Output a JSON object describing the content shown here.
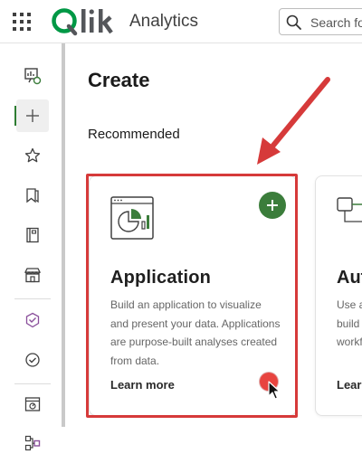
{
  "header": {
    "app_name": "Analytics",
    "search_placeholder": "Search for",
    "logo_text": "Qlik",
    "brand_color": "#2e7d32"
  },
  "sidebar": {
    "items": [
      {
        "icon": "analytics-home-icon"
      },
      {
        "icon": "plus-icon",
        "active": true
      },
      {
        "icon": "star-icon"
      },
      {
        "icon": "bookmark-icon"
      },
      {
        "icon": "notebook-icon"
      },
      {
        "icon": "store-icon"
      },
      {
        "icon": "cube-check-icon"
      },
      {
        "icon": "circle-check-icon"
      },
      {
        "icon": "app-gauge-icon"
      },
      {
        "icon": "flow-icon"
      }
    ]
  },
  "main": {
    "title": "Create",
    "section": "Recommended",
    "cards": [
      {
        "title": "Application",
        "description": "Build an application to visualize and present your data. Applications are purpose-built analyses created from data.",
        "link": "Learn more"
      },
      {
        "title": "Aut",
        "description_lines": [
          "Use a",
          "build",
          "workf"
        ],
        "link": "Lear"
      }
    ]
  },
  "annotation": {
    "highlight_color": "#d63a3a",
    "click_color": "#e8443f"
  }
}
